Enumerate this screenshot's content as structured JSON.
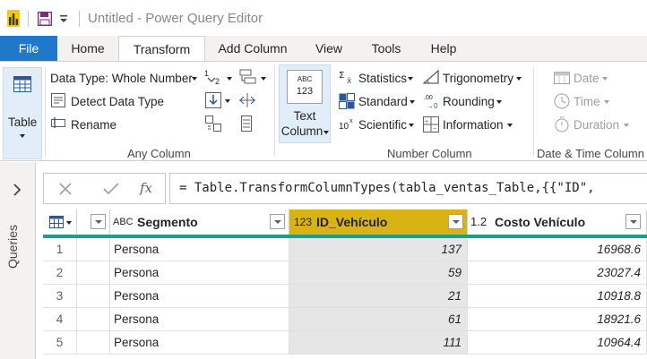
{
  "titlebar": {
    "title": "Untitled - Power Query Editor",
    "icons": [
      "app-icon",
      "save-icon",
      "customize-quick-access-icon"
    ]
  },
  "tabs": [
    {
      "label": "File",
      "selected": false
    },
    {
      "label": "Home",
      "selected": false
    },
    {
      "label": "Transform",
      "selected": true
    },
    {
      "label": "Add Column",
      "selected": false
    },
    {
      "label": "View",
      "selected": false
    },
    {
      "label": "Tools",
      "selected": false
    },
    {
      "label": "Help",
      "selected": false
    }
  ],
  "ribbon": {
    "table_btn": "Table",
    "any_column": {
      "label": "Any Column",
      "data_type": "Data Type: Whole Number",
      "detect": "Detect Data Type",
      "rename": "Rename"
    },
    "text_column": {
      "label_line1": "Text",
      "label_line2": "Column",
      "icon_text_top": "ABC",
      "icon_text_bottom": "123"
    },
    "number_column": {
      "label": "Number Column",
      "statistics": "Statistics",
      "standard": "Standard",
      "scientific": "Scientific",
      "trigonometry": "Trigonometry",
      "rounding": "Rounding",
      "information": "Information"
    },
    "datetime_column": {
      "label": "Date & Time Column",
      "date": "Date",
      "time": "Time",
      "duration": "Duration"
    }
  },
  "queries_pane": {
    "label": "Queries"
  },
  "formula_bar": {
    "fx": "fx",
    "formula": "= Table.TransformColumnTypes(tabla_ventas_Table,{{\"ID\","
  },
  "grid": {
    "columns": [
      {
        "type_icon": "ABC",
        "name": "Segmento",
        "selected": false
      },
      {
        "type_icon": "123",
        "name": "ID_Vehículo",
        "selected": true
      },
      {
        "type_icon": "1.2",
        "name": "Costo Vehículo",
        "selected": false
      }
    ],
    "rows": [
      {
        "n": "1",
        "segmento": "Persona",
        "id": "137",
        "costo": "16968.6"
      },
      {
        "n": "2",
        "segmento": "Persona",
        "id": "59",
        "costo": "23027.4"
      },
      {
        "n": "3",
        "segmento": "Persona",
        "id": "21",
        "costo": "10918.8"
      },
      {
        "n": "4",
        "segmento": "Persona",
        "id": "61",
        "costo": "18921.6"
      },
      {
        "n": "5",
        "segmento": "Persona",
        "id": "111",
        "costo": "10964.4"
      }
    ]
  },
  "colors": {
    "accent": "#1f78c9",
    "selected_column": "#d8b412",
    "quality_bar": "#1aa08c"
  }
}
